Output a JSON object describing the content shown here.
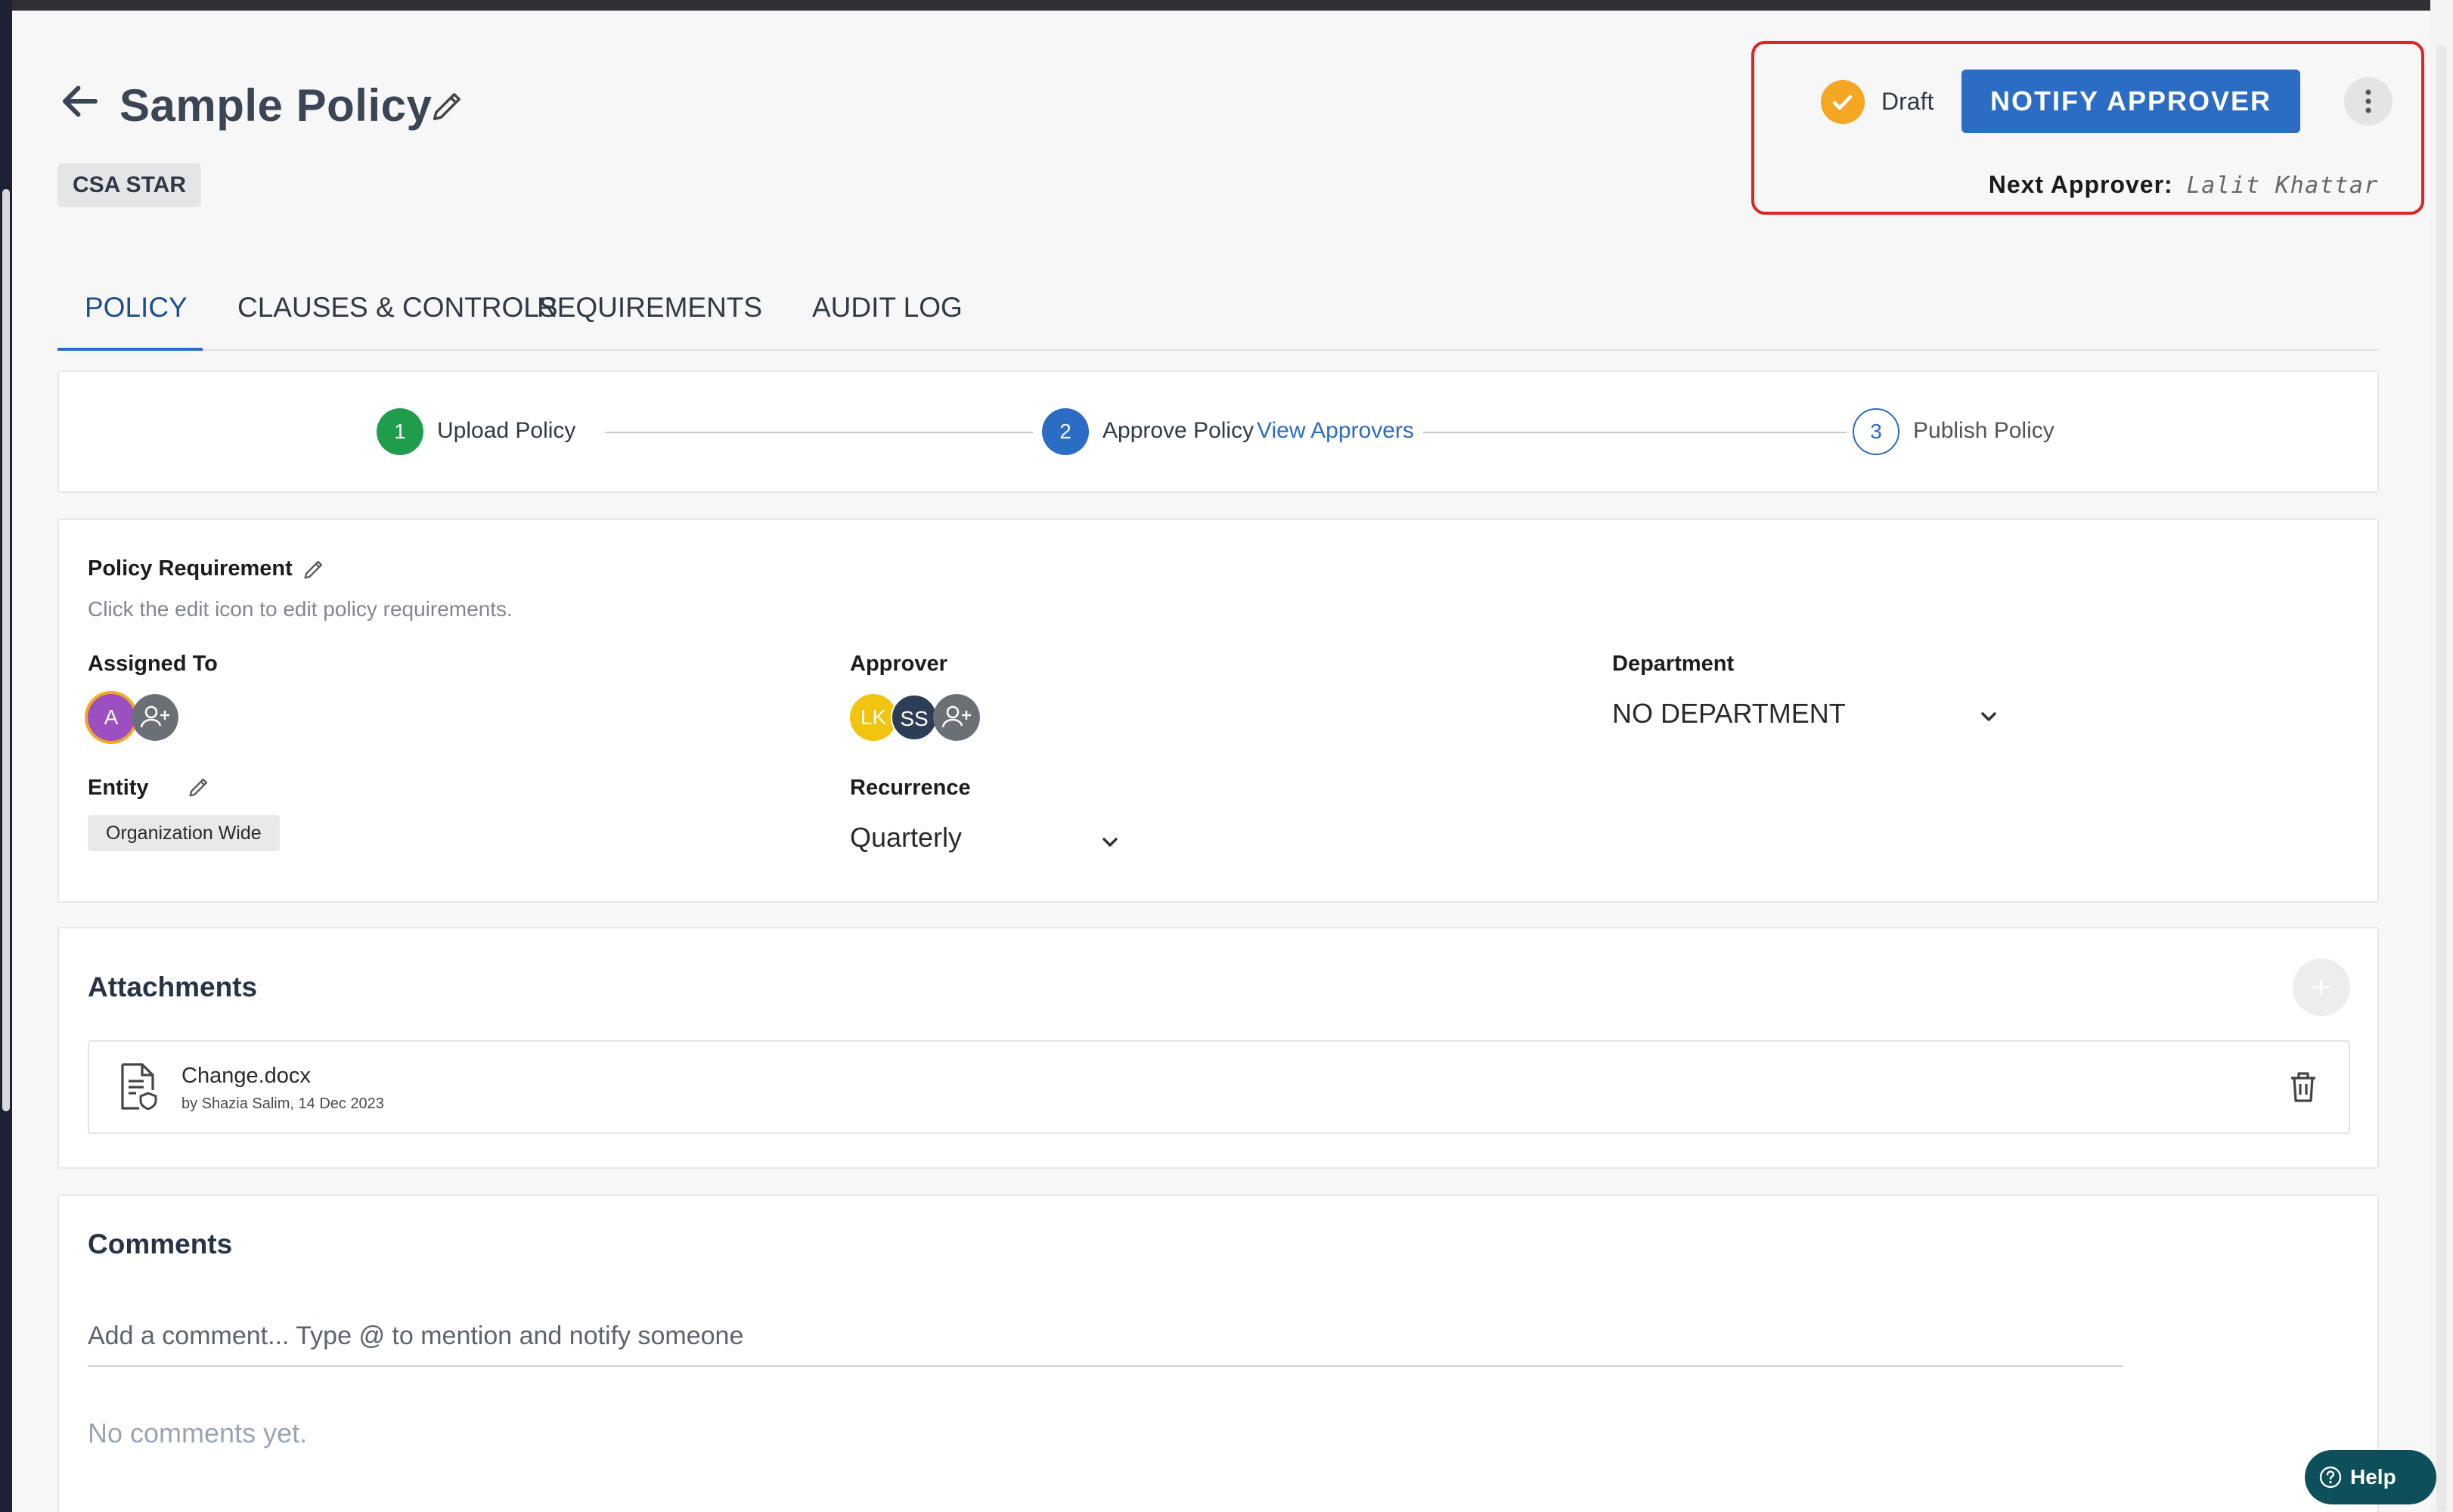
{
  "header": {
    "title": "Sample Policy",
    "tag": "CSA STAR"
  },
  "status": {
    "state_label": "Draft",
    "notify_label": "NOTIFY APPROVER",
    "next_approver_label": "Next Approver:",
    "next_approver_name": "Lalit Khattar"
  },
  "tabs": [
    {
      "label": "POLICY",
      "active": true
    },
    {
      "label": "CLAUSES & CONTROLS",
      "active": false
    },
    {
      "label": "REQUIREMENTS",
      "active": false
    },
    {
      "label": "AUDIT LOG",
      "active": false
    }
  ],
  "stepper": {
    "steps": [
      {
        "number": "1",
        "label": "Upload Policy",
        "state": "complete",
        "color": "#1f9d4d"
      },
      {
        "number": "2",
        "label": "Approve Policy",
        "state": "current",
        "color": "#2b6cc4"
      },
      {
        "number": "3",
        "label": "Publish Policy",
        "state": "pending",
        "color": "#2b6cc4"
      }
    ],
    "view_approvers_label": "View Approvers"
  },
  "requirement": {
    "title": "Policy Requirement",
    "hint": "Click the edit icon to edit policy requirements.",
    "assigned_to": {
      "label": "Assigned To",
      "avatars": [
        {
          "initials": "A",
          "color": "#9b4fc0"
        }
      ]
    },
    "approver": {
      "label": "Approver",
      "avatars": [
        {
          "initials": "LK",
          "color": "#f1c40f"
        },
        {
          "initials": "SS",
          "color": "#2c3e55"
        }
      ]
    },
    "department": {
      "label": "Department",
      "value": "NO DEPARTMENT"
    },
    "entity": {
      "label": "Entity",
      "value": "Organization Wide"
    },
    "recurrence": {
      "label": "Recurrence",
      "value": "Quarterly"
    }
  },
  "attachments": {
    "title": "Attachments",
    "files": [
      {
        "name": "Change.docx",
        "meta": "by Shazia Salim, 14 Dec 2023"
      }
    ]
  },
  "comments": {
    "title": "Comments",
    "placeholder": "Add a comment... Type @ to mention and notify someone",
    "empty_text": "No comments yet."
  },
  "help": {
    "label": "Help"
  },
  "colors": {
    "accent": "#2b6cc4",
    "highlight_border": "#e02424",
    "draft": "#f5a623",
    "step_done": "#1f9d4d"
  }
}
